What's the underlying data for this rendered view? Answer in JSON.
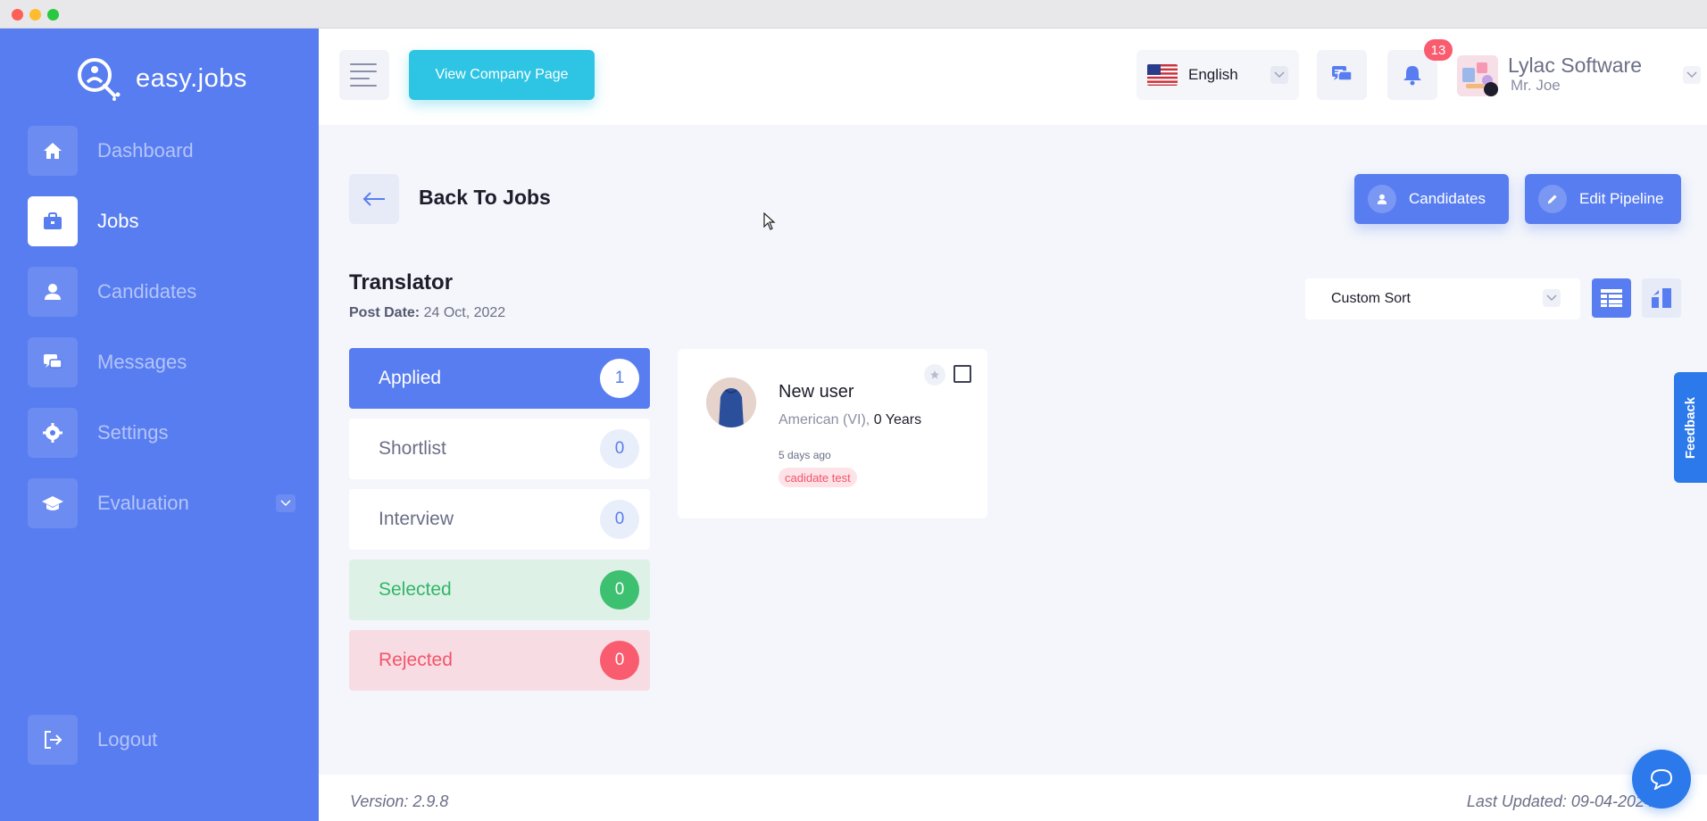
{
  "app": {
    "logo_text": "easy.jobs"
  },
  "sidebar": {
    "items": [
      {
        "label": "Dashboard",
        "icon": "home-icon"
      },
      {
        "label": "Jobs",
        "icon": "briefcase-icon",
        "active": true
      },
      {
        "label": "Candidates",
        "icon": "user-icon"
      },
      {
        "label": "Messages",
        "icon": "chat-icon"
      },
      {
        "label": "Settings",
        "icon": "gear-icon"
      },
      {
        "label": "Evaluation",
        "icon": "graduation-cap-icon"
      }
    ],
    "logout_label": "Logout"
  },
  "header": {
    "company_page_button": "View Company Page",
    "language": "English",
    "notification_count": "13",
    "company_name": "Lylac Software",
    "user_name": "Mr. Joe"
  },
  "page": {
    "back_label": "Back To Jobs",
    "candidates_button": "Candidates",
    "edit_pipeline_button": "Edit Pipeline",
    "job_title": "Translator",
    "post_date_label": "Post Date:",
    "post_date_value": "24 Oct, 2022",
    "sort_label": "Custom Sort"
  },
  "pipeline": {
    "stages": [
      {
        "label": "Applied",
        "count": "1"
      },
      {
        "label": "Shortlist",
        "count": "0"
      },
      {
        "label": "Interview",
        "count": "0"
      },
      {
        "label": "Selected",
        "count": "0"
      },
      {
        "label": "Rejected",
        "count": "0"
      }
    ]
  },
  "candidate": {
    "name": "New user",
    "nationality": "American (VI),",
    "experience": "0 Years",
    "time_ago": "5 days ago",
    "tag": "cadidate test"
  },
  "feedback_label": "Feedback",
  "footer": {
    "version": "Version: 2.9.8",
    "last_updated": "Last Updated: 09-04-2024"
  },
  "colors": {
    "primary": "#587df0",
    "accent_cyan": "#2ec4e3",
    "success": "#3dc070",
    "danger": "#fa5c6f"
  }
}
